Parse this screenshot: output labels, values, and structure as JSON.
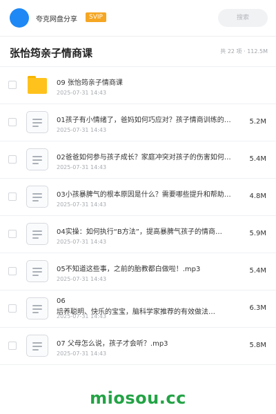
{
  "header": {
    "share_name": "夸克网盘分享",
    "badge": "SVIP",
    "search_placeholder": "搜索"
  },
  "folder": {
    "title": "张怡筠亲子情商课",
    "meta": "共 22 项 · 112.5M"
  },
  "files": [
    {
      "icon": "folder-icon",
      "name": "09 张怡筠亲子情商课",
      "date": "2025-07-31 14:43",
      "size": ""
    },
    {
      "icon": "document-icon",
      "name": "01孩子有小情绪了，爸妈如何巧应对？孩子情商训练的…",
      "date": "2025-07-31 14:43",
      "size": "5.2M"
    },
    {
      "icon": "document-icon",
      "name": "02爸爸如何参与孩子成长？家庭冲突对孩子的伤害如何…",
      "date": "2025-07-31 14:43",
      "size": "5.4M"
    },
    {
      "icon": "document-icon",
      "name": "03小孩暴脾气的根本原因是什么？需要哪些提升和帮助…",
      "date": "2025-07-31 14:43",
      "size": "4.8M"
    },
    {
      "icon": "document-icon",
      "name": "04实操：如何执行“B方法”，提高暴脾气孩子的情商…",
      "date": "2025-07-31 14:43",
      "size": "5.9M"
    },
    {
      "icon": "document-icon",
      "name": "05不知道这些事，之前的胎教都白做啦！.mp3",
      "date": "2025-07-31 14:43",
      "size": "5.4M"
    },
    {
      "icon": "document-icon",
      "name": "06\n培养聪明、快乐的宝宝，脑科学家推荐的有效做法…",
      "date": "2025-07-31 14:43",
      "size": "6.3M"
    },
    {
      "icon": "document-icon",
      "name": "07 父母怎么说，孩子才会听？.mp3",
      "date": "2025-07-31 14:43",
      "size": "5.8M"
    }
  ],
  "watermark": "miosou.cc"
}
